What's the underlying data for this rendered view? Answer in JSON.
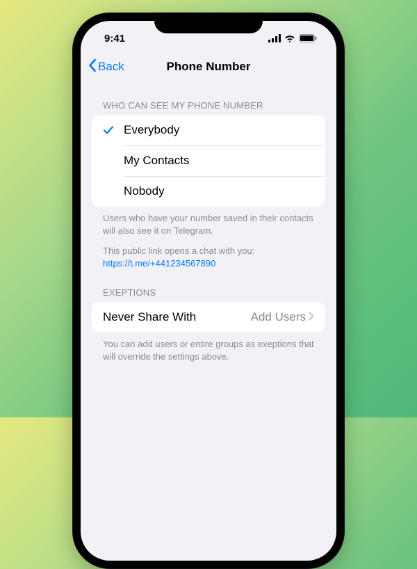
{
  "status": {
    "time": "9:41"
  },
  "nav": {
    "back": "Back",
    "title": "Phone Number"
  },
  "sections": {
    "visibility": {
      "header": "WHO CAN SEE MY PHONE NUMBER",
      "options": [
        "Everybody",
        "My Contacts",
        "Nobody"
      ],
      "selected_index": 0,
      "footer1": "Users who have your number saved in their contacts will also see it on Telegram.",
      "footer2_prefix": "This public link opens a chat with you:",
      "footer2_link": "https://t.me/+441234567890"
    },
    "exceptions": {
      "header": "EXEPTIONS",
      "row_label": "Never Share With",
      "row_value": "Add Users",
      "footer": "You can add users or entire groups as exeptions that will override the settings above."
    }
  }
}
